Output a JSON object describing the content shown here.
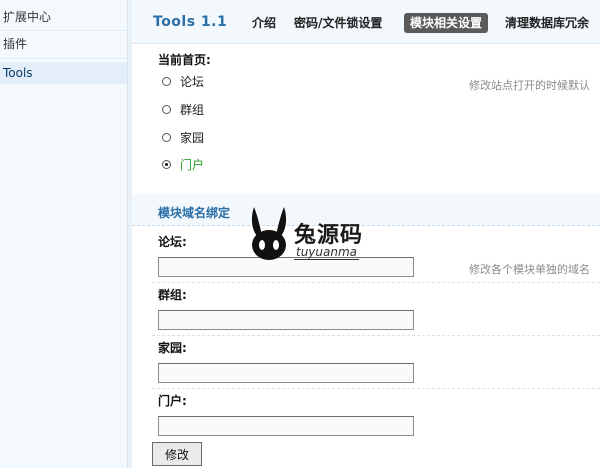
{
  "sidebar": {
    "items": [
      {
        "label": "扩展中心",
        "active": false
      },
      {
        "label": "插件",
        "active": false
      },
      {
        "label": "Tools",
        "active": true
      }
    ]
  },
  "header": {
    "title": "Tools 1.1",
    "tabs": [
      {
        "label": "介绍",
        "active": false
      },
      {
        "label": "密码/文件锁设置",
        "active": false
      },
      {
        "label": "模块相关设置",
        "active": true
      },
      {
        "label": "清理数据库冗余",
        "active": false
      }
    ]
  },
  "homepage": {
    "label": "当前首页:",
    "hint": "修改站点打开的时候默认",
    "options": [
      {
        "label": "论坛",
        "checked": false
      },
      {
        "label": "群组",
        "checked": false
      },
      {
        "label": "家园",
        "checked": false
      },
      {
        "label": "门户",
        "checked": true
      }
    ]
  },
  "domain_binding": {
    "title": "模块域名绑定",
    "hint": "修改各个模块单独的域名",
    "fields": [
      {
        "label": "论坛:",
        "value": ""
      },
      {
        "label": "群组:",
        "value": ""
      },
      {
        "label": "家园:",
        "value": ""
      },
      {
        "label": "门户:",
        "value": ""
      }
    ]
  },
  "submit_label": "修改",
  "watermark": {
    "text": "兔源码",
    "sub": "tuyuanma"
  }
}
